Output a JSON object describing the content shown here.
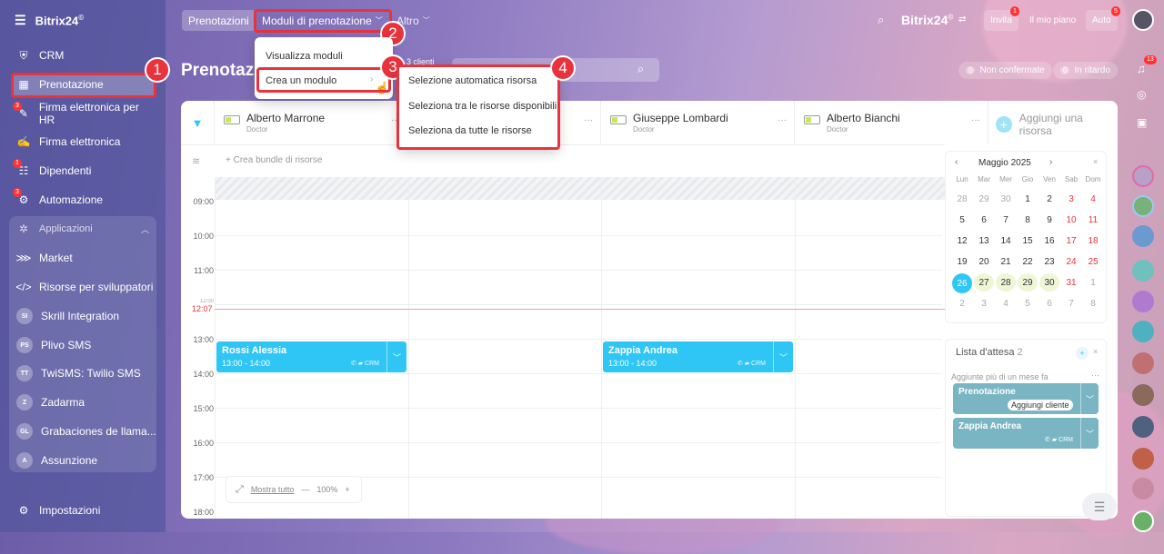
{
  "sidebar": {
    "brand": "Bitrix24",
    "brand_mark": "©",
    "items": [
      {
        "label": "CRM",
        "badge": ""
      },
      {
        "label": "Prenotazione",
        "badge": ""
      },
      {
        "label": "Firma elettronica per HR",
        "badge": "3"
      },
      {
        "label": "Firma elettronica",
        "badge": ""
      },
      {
        "label": "Dipendenti",
        "badge": "1"
      },
      {
        "label": "Automazione",
        "badge": "3"
      }
    ],
    "apps_label": "Applicazioni",
    "apps": [
      {
        "label": "Market",
        "abbr": ""
      },
      {
        "label": "Risorse per sviluppatori",
        "abbr": ""
      },
      {
        "label": "Skrill Integration",
        "abbr": "SI"
      },
      {
        "label": "Plivo SMS",
        "abbr": "PS"
      },
      {
        "label": "TwiSMS: Twilio SMS",
        "abbr": "TT"
      },
      {
        "label": "Zadarma",
        "abbr": "Z"
      },
      {
        "label": "Grabaciones de llama...",
        "abbr": "GL"
      },
      {
        "label": "Assunzione",
        "abbr": "A"
      }
    ],
    "settings": "Impostazioni"
  },
  "topbar": {
    "tabs": [
      "Prenotazioni",
      "Moduli di prenotazione",
      "Altro"
    ],
    "brand": "Bitrix24",
    "brand_mark": "©",
    "invite": "Invita",
    "invite_badge": "1",
    "my_plan": "Il mio piano",
    "auto": "Auto",
    "auto_badge": "5"
  },
  "page": {
    "title": "Prenotazi",
    "clients": "3 clienti",
    "unconfirmed_count": "0",
    "unconfirmed": "Non confermate",
    "late_count": "0",
    "late": "In ritardo"
  },
  "menu_modules": [
    "Visualizza moduli",
    "Crea un modulo"
  ],
  "submenu": [
    "Selezione automatica risorsa",
    "Seleziona tra le risorse disponibili",
    "Seleziona da tutte le risorse"
  ],
  "steps": [
    "1",
    "2",
    "3",
    "4"
  ],
  "resources": [
    {
      "name": "Alberto Marrone",
      "role": "Doctor"
    },
    {
      "name": "",
      "role": ""
    },
    {
      "name": "Giuseppe Lombardi",
      "role": "Doctor"
    },
    {
      "name": "Alberto Bianchi",
      "role": "Doctor"
    }
  ],
  "add_resource": "Aggiungi una risorsa",
  "bundle": "+ Crea bundle di risorse",
  "hours": [
    "09:00",
    "10:00",
    "11:00",
    "12:00",
    "13:00",
    "14:00",
    "15:00",
    "16:00",
    "17:00",
    "18:00"
  ],
  "now": "12:07",
  "events": [
    {
      "name": "Rossi Alessia",
      "time": "13:00 - 14:00",
      "crm": "CRM"
    },
    {
      "name": "Zappia Andrea",
      "time": "13:00 - 14:00",
      "crm": "CRM"
    }
  ],
  "zoom": {
    "show_all": "Mostra tutto",
    "minus": "—",
    "value": "100%",
    "plus": "+"
  },
  "calendar": {
    "month": "Maggio 2025",
    "weekdays": [
      "Lun",
      "Mar",
      "Mer",
      "Gio",
      "Ven",
      "Sab",
      "Dom"
    ],
    "weeks": [
      [
        "28",
        "29",
        "30",
        "1",
        "2",
        "3",
        "4"
      ],
      [
        "5",
        "6",
        "7",
        "8",
        "9",
        "10",
        "11"
      ],
      [
        "12",
        "13",
        "14",
        "15",
        "16",
        "17",
        "18"
      ],
      [
        "19",
        "20",
        "21",
        "22",
        "23",
        "24",
        "25"
      ],
      [
        "26",
        "27",
        "28",
        "29",
        "30",
        "31",
        "1"
      ],
      [
        "2",
        "3",
        "4",
        "5",
        "6",
        "7",
        "8"
      ]
    ]
  },
  "waitlist": {
    "title": "Lista d'attesa",
    "count": "2",
    "added": "Aggiunte più di un mese fa",
    "items": [
      {
        "name": "Prenotazione",
        "action": "Aggiungi cliente"
      },
      {
        "name": "Zappia Andrea",
        "action": "CRM"
      }
    ]
  },
  "right_strip": {
    "notif_badge": "13"
  },
  "colors": {
    "accent": "#2fc6f6",
    "highlight": "#e8333c",
    "sidebar": "#4a52a0"
  }
}
